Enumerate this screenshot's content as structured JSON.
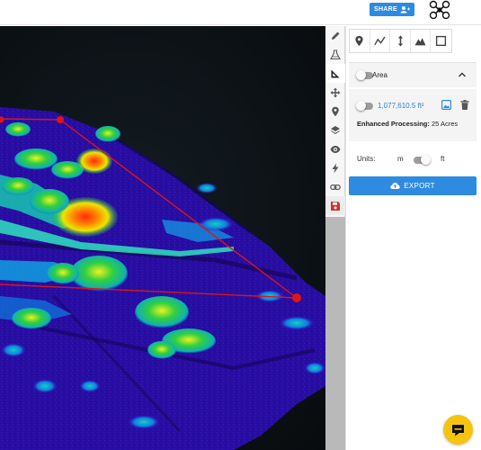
{
  "header": {
    "share_label": "SHARE",
    "share_icon": "add-person-icon",
    "logo_icon": "drone-logo-icon"
  },
  "sidebar_tools": [
    {
      "name": "pencil-icon"
    },
    {
      "name": "volume-flask-icon"
    },
    {
      "name": "measure-angle-icon",
      "active": true
    },
    {
      "name": "move-arrows-icon"
    },
    {
      "name": "location-pin-icon"
    },
    {
      "name": "layers-icon"
    },
    {
      "name": "eye-icon"
    },
    {
      "name": "lightning-icon"
    },
    {
      "name": "link-icon"
    },
    {
      "name": "save-icon",
      "color": "#d32f2f"
    }
  ],
  "measure_tools": [
    {
      "name": "point-pin-icon"
    },
    {
      "name": "polyline-icon"
    },
    {
      "name": "height-arrow-icon"
    },
    {
      "name": "profile-mountain-icon"
    },
    {
      "name": "area-square-icon"
    }
  ],
  "area_section": {
    "label": "Area",
    "expanded": true,
    "measurement_value": "1,077,610.5 ft²",
    "enhanced_label": "Enhanced Processing:",
    "enhanced_value": "25 Acres"
  },
  "units": {
    "label": "Units:",
    "option_a": "m",
    "option_b": "ft",
    "selected": "ft"
  },
  "export": {
    "label": "EXPORT",
    "icon": "cloud-upload-icon"
  },
  "chat": {
    "icon": "chat-bubble-icon"
  },
  "colors": {
    "accent": "#2e8bdf",
    "measure_line": "#e01414",
    "save": "#d32f2f",
    "chat": "#f4c40f"
  }
}
